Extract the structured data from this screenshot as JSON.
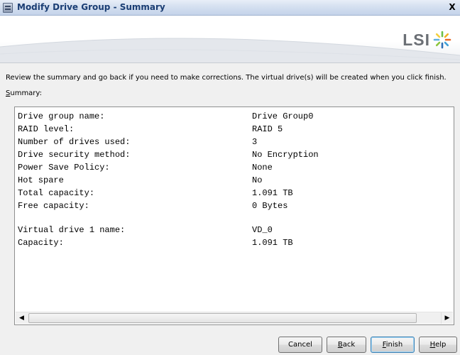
{
  "window": {
    "title": "Modify Drive Group - Summary",
    "close_label": "X"
  },
  "banner": {
    "logo_text": "LSI"
  },
  "instruction_text": "Review the summary and go back if you need to make corrections. The virtual drive(s) will be created when you click finish.",
  "summary": {
    "label_first": "S",
    "label_rest": "ummary:",
    "rows": [
      {
        "key": "Drive group name:",
        "value": "Drive Group0"
      },
      {
        "key": "RAID level:",
        "value": "RAID 5"
      },
      {
        "key": "Number of drives used:",
        "value": "3"
      },
      {
        "key": "Drive security method:",
        "value": "No Encryption"
      },
      {
        "key": "Power Save Policy:",
        "value": "None"
      },
      {
        "key": "Hot spare",
        "value": "No"
      },
      {
        "key": "Total capacity:",
        "value": "1.091 TB"
      },
      {
        "key": "Free capacity:",
        "value": "0 Bytes"
      },
      {
        "key": "Virtual drive 1 name:",
        "value": "VD_0"
      },
      {
        "key": "Capacity:",
        "value": "1.091 TB"
      }
    ]
  },
  "buttons": {
    "cancel": "Cancel",
    "back_first": "B",
    "back_rest": "ack",
    "finish_first": "F",
    "finish_rest": "inish",
    "help_first": "H",
    "help_rest": "elp"
  },
  "colors": {
    "title_text": "#1a3d73",
    "logo_gray": "#6b6f75"
  }
}
